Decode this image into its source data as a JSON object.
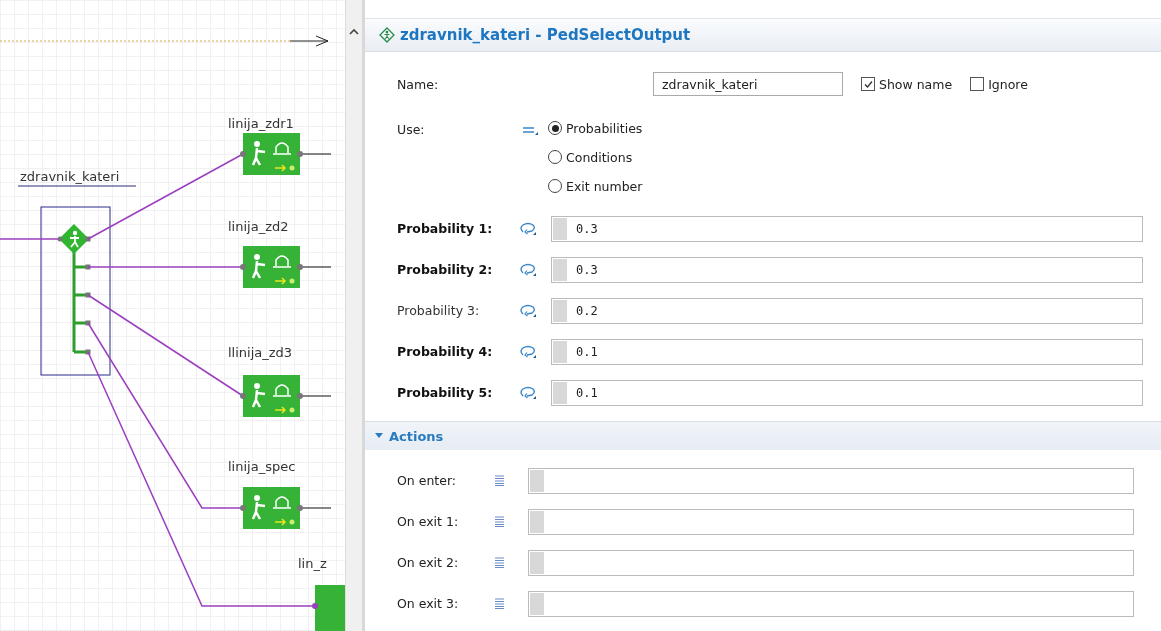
{
  "diagram": {
    "select_block": {
      "label": "zdravnik_kateri"
    },
    "blocks": [
      {
        "label": "linija_zdr1"
      },
      {
        "label": "linija_zd2"
      },
      {
        "label": "llinija_zd3"
      },
      {
        "label": "linija_spec"
      },
      {
        "label": "lin_z"
      }
    ]
  },
  "properties": {
    "title": "zdravnik_kateri - PedSelectOutput",
    "name": {
      "label": "Name:",
      "value": "zdravnik_kateri"
    },
    "checkboxes": [
      {
        "label": "Show name",
        "checked": true
      },
      {
        "label": "Ignore",
        "checked": false
      }
    ],
    "use": {
      "label": "Use:",
      "options": [
        {
          "label": "Probabilities",
          "selected": true
        },
        {
          "label": "Conditions",
          "selected": false
        },
        {
          "label": "Exit number",
          "selected": false
        }
      ]
    },
    "probabilities": [
      {
        "label": "Probability 1:",
        "bold": true,
        "value": "0.3"
      },
      {
        "label": "Probability 2:",
        "bold": true,
        "value": "0.3"
      },
      {
        "label": "Probability 3:",
        "bold": false,
        "value": "0.2"
      },
      {
        "label": "Probability 4:",
        "bold": true,
        "value": "0.1"
      },
      {
        "label": "Probability 5:",
        "bold": true,
        "value": "0.1"
      }
    ],
    "actions": {
      "title": "Actions",
      "expanded": true,
      "rows": [
        {
          "label": "On enter:"
        },
        {
          "label": "On exit 1:"
        },
        {
          "label": "On exit 2:"
        },
        {
          "label": "On exit 3:"
        }
      ]
    }
  }
}
